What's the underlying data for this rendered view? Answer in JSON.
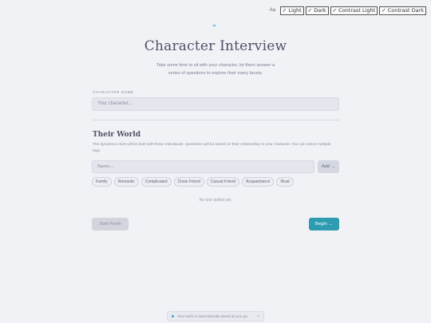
{
  "theme_bar": {
    "font_toggle": "Aa",
    "buttons": [
      "✓ Light",
      "✓ Dark",
      "✓ Contrast Light",
      "✓ Contrast Dark"
    ]
  },
  "header": {
    "title": "Character Interview",
    "subtitle": "Take some time to sit with your character, let them answer a series of questions to explore their many facets."
  },
  "character": {
    "label": "CHARACTER NAME",
    "placeholder": "Your character..."
  },
  "world": {
    "title": "Their World",
    "description": "The dynamics chart will be built with these individuals. Questions will be based on their relationship to your character. You can select multiple tags.",
    "name_placeholder": "Name...",
    "add_label": "Add →",
    "tags": [
      "Family",
      "Romantic",
      "Complicated",
      "Close Friend",
      "Casual Friend",
      "Acquaintance",
      "Rival"
    ],
    "empty": "No one added yet."
  },
  "actions": {
    "start_fresh": "Start Fresh",
    "begin": "Begin →"
  },
  "toast": {
    "text": "Your work is automatically saved as you go.",
    "close": "×"
  },
  "colors": {
    "accent": "#2f9bb0",
    "background": "#f1f2f6"
  }
}
